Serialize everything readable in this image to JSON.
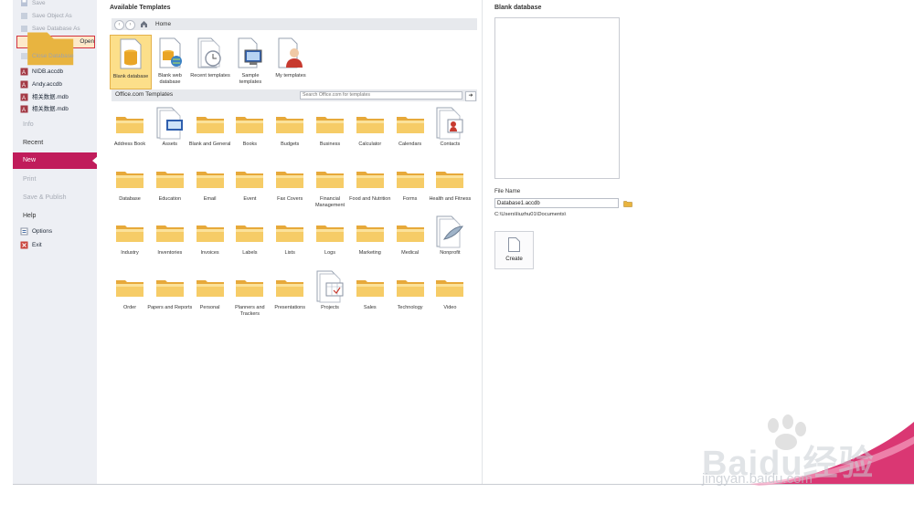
{
  "sidebar": {
    "save": "Save",
    "save_object_as": "Save Object As",
    "save_database_as": "Save Database As",
    "open": "Open",
    "close_database": "Close Database",
    "recent_files": [
      "NIDB.accdb",
      "Andy.accdb",
      "相关数据.mdb",
      "相关数据.mdb"
    ],
    "info": "Info",
    "recent": "Recent",
    "new": "New",
    "print": "Print",
    "save_publish": "Save & Publish",
    "help": "Help",
    "options": "Options",
    "exit": "Exit"
  },
  "main": {
    "title": "Available Templates",
    "home": "Home",
    "top_tiles": [
      {
        "label": "Blank database",
        "icon": "blank-database-icon"
      },
      {
        "label": "Blank web database",
        "icon": "blank-web-database-icon"
      },
      {
        "label": "Recent templates",
        "icon": "recent-templates-icon"
      },
      {
        "label": "Sample templates",
        "icon": "sample-templates-icon"
      },
      {
        "label": "My templates",
        "icon": "my-templates-icon"
      }
    ],
    "office_title": "Office.com Templates",
    "search_placeholder": "Search Office.com for templates",
    "templates": [
      "Address Book",
      "Assets",
      "Blank and General",
      "Books",
      "Budgets",
      "Business",
      "Calculator",
      "Calendars",
      "Contacts",
      "Database",
      "Education",
      "Email",
      "Event",
      "Fax Covers",
      "Financial Management",
      "Food and Nutrition",
      "Forms",
      "Health and Fitness",
      "Industry",
      "Inventories",
      "Invoices",
      "Labels",
      "Lists",
      "Logs",
      "Marketing",
      "Medical",
      "Nonprofit",
      "Order",
      "Papers and Reports",
      "Personal",
      "Planners and Trackers",
      "Presentations",
      "Projects",
      "Sales",
      "Technology",
      "Video"
    ]
  },
  "right": {
    "title": "Blank database",
    "file_name_label": "File Name",
    "file_name": "Database1.accdb",
    "path": "C:\\Users\\liuzhu01\\Documents\\",
    "create": "Create"
  },
  "watermark": {
    "line1": "Baidu经验",
    "line2": "jingyan.baidu.com"
  },
  "colors": {
    "accent": "#c01c5b",
    "selected": "#fcdf8a",
    "highlight_border": "#d33240",
    "folder": "#f2c14e"
  }
}
